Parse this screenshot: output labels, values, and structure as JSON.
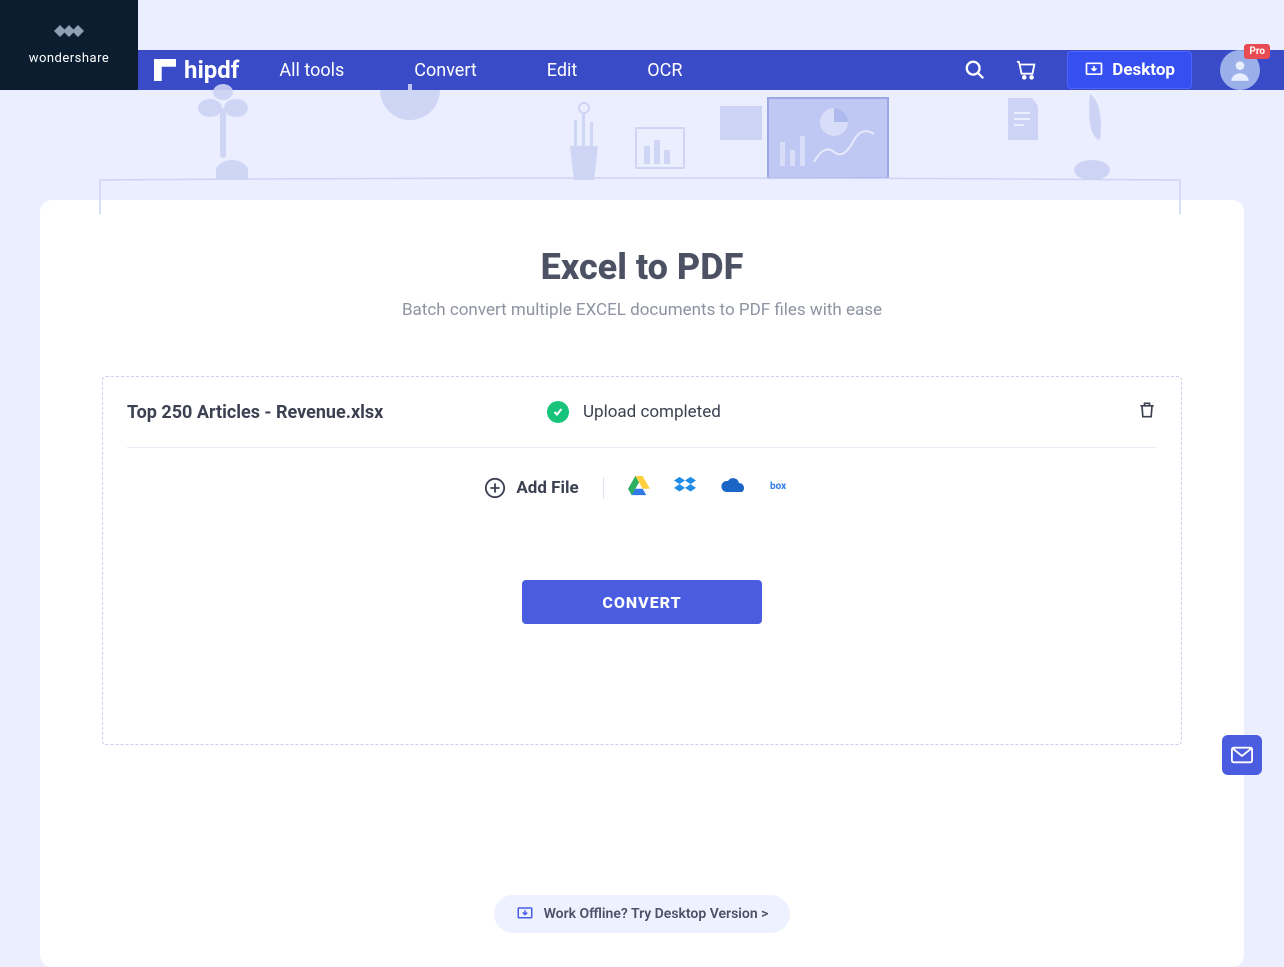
{
  "header": {
    "brand": "wondershare",
    "product": "hipdf",
    "nav": {
      "all_tools": "All tools",
      "convert": "Convert",
      "edit": "Edit",
      "ocr": "OCR"
    },
    "desktop_label": "Desktop",
    "pro_badge": "Pro"
  },
  "main": {
    "title": "Excel to PDF",
    "subtitle": "Batch convert multiple EXCEL documents to PDF files with ease",
    "file": {
      "name": "Top 250 Articles - Revenue.xlsx",
      "status": "Upload completed"
    },
    "add_file_label": "Add File",
    "convert_label": "CONVERT",
    "offline_label": "Work Offline? Try Desktop Version >"
  }
}
